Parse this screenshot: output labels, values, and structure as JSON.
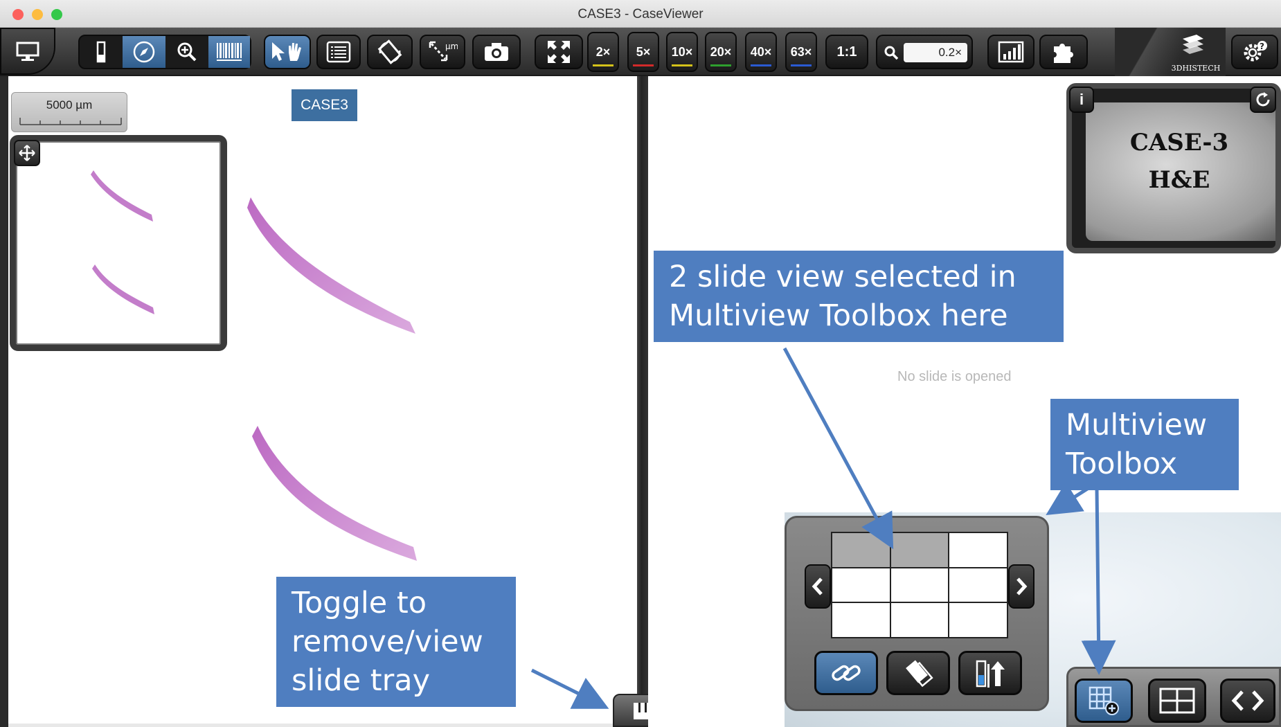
{
  "window": {
    "title": "CASE3 - CaseViewer"
  },
  "toolbar": {
    "magnifications": [
      "2×",
      "5×",
      "10×",
      "20×",
      "40×",
      "63×"
    ],
    "mag_colors": [
      "#d4c21a",
      "#d22a2a",
      "#d4c21a",
      "#2ea02e",
      "#2a5ad2",
      "#2a5ad2"
    ],
    "one_to_one": "1:1",
    "zoom_value": "0.2×",
    "logo_text": "3DHISTECH"
  },
  "left_view": {
    "scale_label": "5000 µm",
    "case_label": "CASE3"
  },
  "right_view": {
    "empty_message": "No slide is opened",
    "slide_label": {
      "line1": "CASE-3",
      "line2": "H&E"
    }
  },
  "multiview": {
    "grid": {
      "rows": 3,
      "cols": 3,
      "selected_cells": 2
    }
  },
  "callouts": {
    "two_slide": "2 slide view selected in Multiview Toolbox here",
    "toolbox": "Multiview Toolbox",
    "tray": "Toggle to remove/view slide tray"
  },
  "colors": {
    "accent": "#3d6fa0",
    "callout": "#4f7ec0",
    "active_button": "#4a7aad"
  }
}
